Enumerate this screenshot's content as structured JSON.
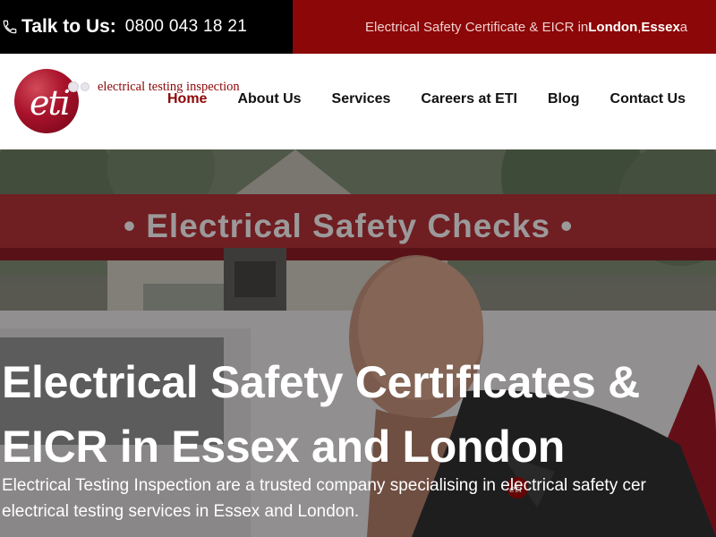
{
  "topbar": {
    "talk_label": "Talk to Us:",
    "phone_number": "0800 043 18 21",
    "tagline_prefix": "Electrical Safety Certificate & EICR in ",
    "tagline_city1": "London",
    "tagline_sep": ", ",
    "tagline_city2": "Essex",
    "tagline_suffix": " a",
    "left_bg": "#000000",
    "right_bg": "#8c0707"
  },
  "logo": {
    "mark": "eti",
    "text": "electrical testing inspection",
    "brand_color": "#8c0707"
  },
  "nav": {
    "items": [
      {
        "label": "Home",
        "active": true
      },
      {
        "label": "About Us",
        "active": false
      },
      {
        "label": "Services",
        "active": false
      },
      {
        "label": "Careers at ETI",
        "active": false
      },
      {
        "label": "Blog",
        "active": false
      },
      {
        "label": "Contact Us",
        "active": false
      }
    ]
  },
  "hero": {
    "van_sign": "• Electrical Safety Checks •",
    "badge_text": "eti",
    "title": "Electrical Safety Certificates & EICR in Essex and London",
    "text_line1": "Electrical Testing Inspection are a trusted company specialising in electrical safety cer",
    "text_line2": "electrical testing services in Essex and London."
  }
}
